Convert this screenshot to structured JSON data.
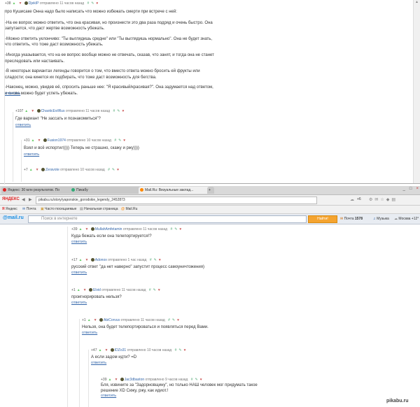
{
  "top_window": {
    "scroll_arrow": "▲",
    "c1": {
      "rating": "+38",
      "user": "DjekIP",
      "action": "отправлено",
      "time": "11 часов назад",
      "paragraphs": [
        "про Кушисаке Онна надо было написать что можно избежать смерти при встрече с ней:",
        "-На ее вопрос можно ответить, что она красивая, но произнести это два раза подряд и очень быстро. Она запутается, что даст жертве возможность убежать.",
        "-Можно ответить уклончиво: \"Ты выглядишь средне\" или \"Ты выглядишь нормально\". Она не будет знать, что ответить, что тоже даст возможность убежать.",
        "-Иногда указывается, что на ее вопрос вообще можно не отвечать, сказав, что занят, и тогда она не станет преследовать или настаивать.",
        "-В некоторых вариантах легенды говорится о том, что вместо ответа можно бросить ей фрукты или сладости; она кинется их подбирать, что тоже даст возможность для бегства.",
        "-Наконец, можно, увидев её, спросить раньше нее: \"Я красивый/красивая?\". Она задумается над ответом, и снова можно будет успеть убежать."
      ],
      "reply": "ответить"
    },
    "c2": {
      "rating": "+107",
      "user": "ChaoticEvilRus",
      "action": "отправлено",
      "time": "11 часов назад",
      "text": "Где вариант \"Не зассать и познакомиться\"?",
      "reply": "ответить"
    },
    "c3": {
      "rating": "+31",
      "user": "Fusion1974",
      "action": "отправлено",
      "time": "10 часов назад",
      "text": "Взял и всё испортил)))) Теперь не страшно, скажу и ржу))))",
      "reply": "ответить"
    },
    "c4": {
      "rating": "+7",
      "user": "Zeravote",
      "action": "отправлено",
      "time": "10 часов назад"
    }
  },
  "browser": {
    "tabs": [
      {
        "label": "Яндекс: 30 млн результатов. По",
        "color": "#d22"
      },
      {
        "label": "Пикабу",
        "color": "#3a7"
      },
      {
        "label": "Mail.Ru: Визуальные заклад...",
        "color": "#f80",
        "active": true
      }
    ],
    "new_tab": "+",
    "address": {
      "brand": "ЯНДЕКС",
      "url": "pikabu.ru/story/yaponskie_gorodskie_legendy_2452873",
      "weather": "+6"
    },
    "bookmarks": [
      "Яндекс",
      "Почта",
      "Часто посещаемые",
      "Начальная страница",
      "Mail.Ru"
    ],
    "mailru": {
      "logo": "@mail.ru",
      "placeholder": "Поиск в интернете",
      "search_btn": "Найти!",
      "mail": "Почта",
      "mail_count": "1578",
      "music": "Музыка",
      "weather": "Москва +12°"
    }
  },
  "bottom_comments": [
    {
      "rating": "+39",
      "user": "MullahAmfetamin",
      "action": "отправлено",
      "time": "11 часов назад",
      "text": [
        "Куда бежать если она телепортируется!?"
      ],
      "reply": "ответить"
    },
    {
      "rating": "+17",
      "user": "Adonox",
      "action": "отправлено",
      "time": "1 час назад",
      "text": [
        "русский ответ \"да нет наверно\" запустит процесс самоуничтожения)"
      ],
      "reply": "ответить"
    },
    {
      "rating": "+1",
      "user": "Elvid",
      "action": "отправлено",
      "time": "11 часов назад",
      "text": [
        "проигнорировать нельзя?"
      ],
      "reply": "ответить"
    },
    {
      "rating": "+1",
      "user": "AbiCorvus",
      "action": "отправлено",
      "time": "11 часов назад",
      "text": [
        "Нельзя, она будет телепортироваться и появляться перед Вами."
      ],
      "reply": "ответить"
    },
    {
      "rating": "+47",
      "user": "IDZo31",
      "action": "отправлено",
      "time": "10 часов назад",
      "text": [
        "А если задом идти? =D"
      ],
      "reply": "ответить"
    },
    {
      "rating": "+39",
      "user": "Jac3dbaston",
      "action": "отправлено",
      "time": "9 часов назад",
      "text": [
        "Бля, извините за \"Задорновщину\", но только НАШ человек мог придумать такое",
        "решение XD Сижу, ржу, как идиот.!"
      ],
      "reply": "ответить"
    }
  ],
  "watermark": "pikabu.ru"
}
